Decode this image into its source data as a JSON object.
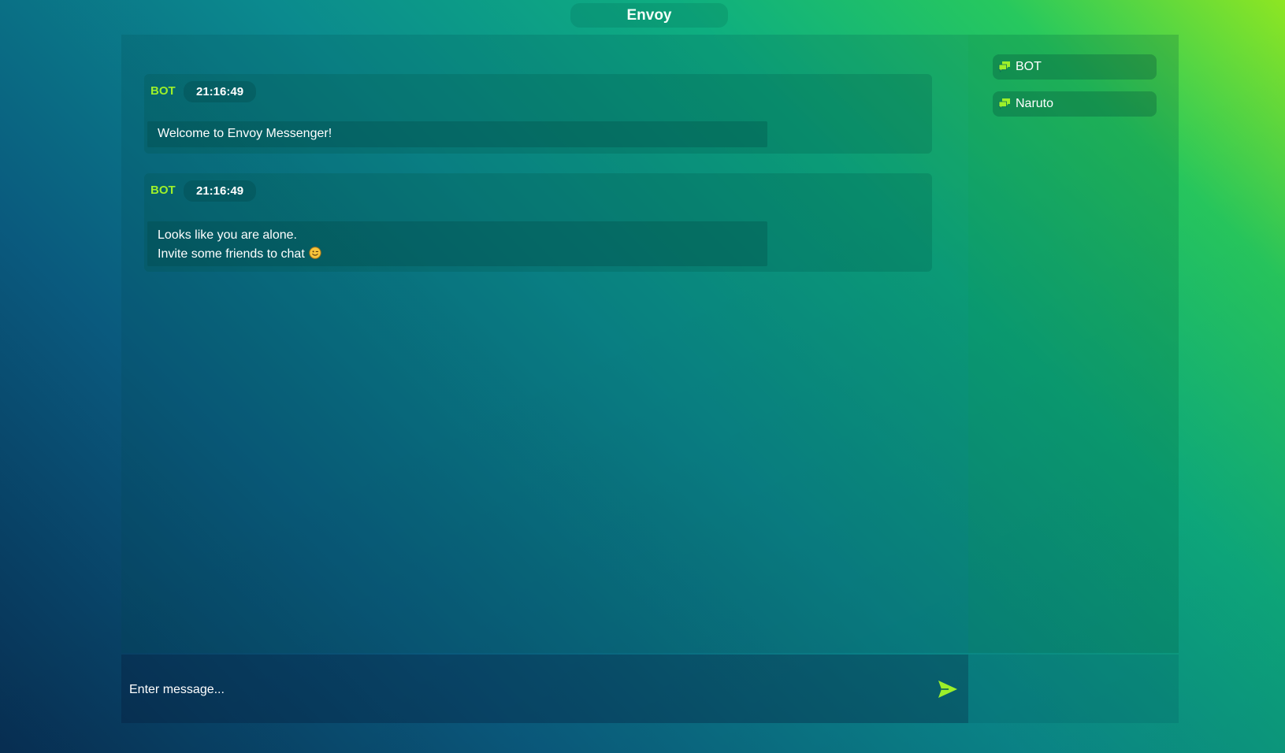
{
  "app": {
    "title": "Envoy"
  },
  "messages": [
    {
      "sender": "BOT",
      "time": "21:16:49",
      "lines": [
        "Welcome to Envoy Messenger!"
      ]
    },
    {
      "sender": "BOT",
      "time": "21:16:49",
      "lines": [
        "Looks like you are alone.",
        "Invite some friends to chat"
      ],
      "emoji": "winking-face-icon"
    }
  ],
  "users": [
    {
      "name": "BOT",
      "icon": "chat-bubbles-icon"
    },
    {
      "name": "Naruto",
      "icon": "chat-bubbles-icon"
    }
  ],
  "composer": {
    "placeholder": "Enter message...",
    "send_icon": "send-arrow-icon"
  },
  "colors": {
    "accent": "#9df02a",
    "text": "#ffffff",
    "gradient_dark": "#072e52",
    "gradient_mid": "#0b8a8e",
    "gradient_light": "#8ee622"
  }
}
